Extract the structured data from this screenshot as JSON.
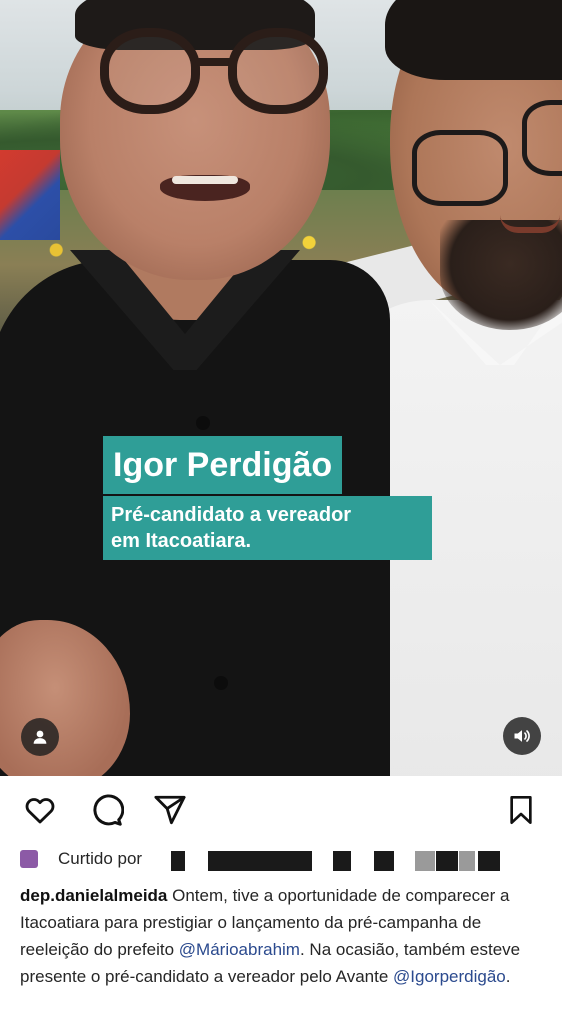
{
  "overlay": {
    "name": "Igor Perdigão",
    "subtitle_line1": "Pré-candidato a vereador",
    "subtitle_line2": "em Itacoatiara."
  },
  "icons": {
    "tagged_user": "person-icon",
    "sound": "speaker-icon",
    "like": "heart-icon",
    "comment": "comment-bubble-icon",
    "share": "paper-plane-icon",
    "save": "bookmark-icon"
  },
  "likes": {
    "prefix": "Curtido por"
  },
  "post": {
    "username": "dep.danielalmeida",
    "text_1": " Ontem, tive a oportunidade de comparecer a Itacoatiara para prestigiar o lançamento da pré-campanha de reeleição do prefeito ",
    "mention_1": "@Márioabrahim",
    "text_2": ". Na ocasião, também esteve presente o pré-candidato a vereador pelo Avante ",
    "mention_2": "@Igorperdigão",
    "text_3": "."
  },
  "colors": {
    "caption_overlay": "#2f9e97",
    "mention": "#2b4a8e"
  }
}
